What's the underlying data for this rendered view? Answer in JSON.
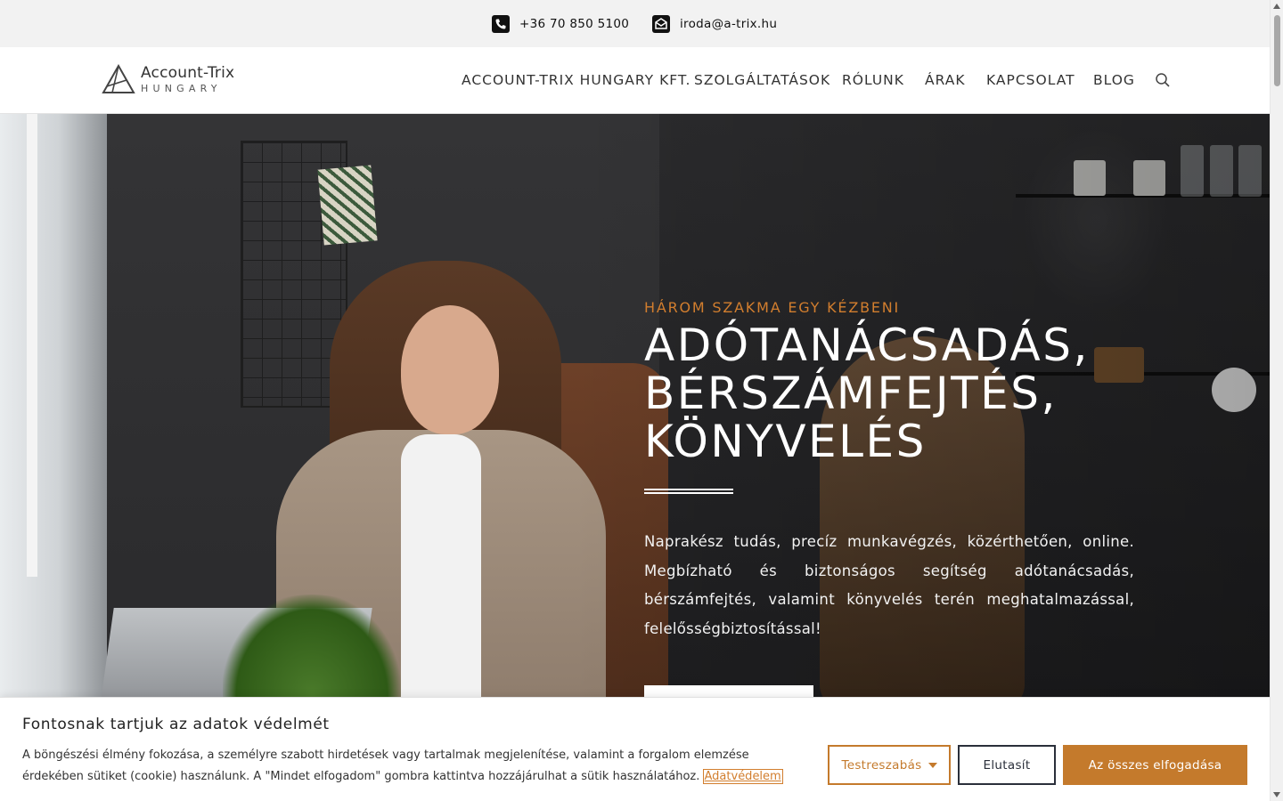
{
  "topbar": {
    "phone_icon": "phone-icon",
    "phone": "+36 70 850 5100",
    "mail_icon": "mail-icon",
    "email": "iroda@a-trix.hu"
  },
  "header": {
    "logo": {
      "name": "Account-Trix",
      "sub": "HUNGARY"
    },
    "nav": [
      {
        "label": "ACCOUNT-TRIX HUNGARY KFT."
      },
      {
        "label": "SZOLGÁLTATÁSOK"
      },
      {
        "label": "RÓLUNK"
      },
      {
        "label": "ÁRAK"
      },
      {
        "label": "KAPCSOLAT"
      },
      {
        "label": "BLOG"
      }
    ],
    "search_icon": "search-icon"
  },
  "hero": {
    "kicker": "HÁROM SZAKMA EGY KÉZBENI",
    "headline": [
      "ADÓTANÁCSADÁS,",
      "BÉRSZÁMFEJTÉS,",
      "KÖNYVELÉS"
    ],
    "description": "Naprakész tudás, precíz munkavégzés, közérthetően, online. Megbízható és biztonságos segítség adótanácsadás, bérszámfejtés, valamint könyvelés terén meghatalmazással, felelősségbiztosítással!"
  },
  "cookie": {
    "title": "Fontosnak tartjuk az adatok védelmét",
    "text": "A böngészési élmény fokozása, a személyre szabott hirdetések vagy tartalmak megjelenítése, valamint a forgalom elemzése érdekében sütiket (cookie) használunk. A \"Mindet elfogadom\" gombra kattintva hozzájárulhat a sütik használatához.",
    "link": "Adatvédelem",
    "customize": "Testreszabás",
    "reject": "Elutasít",
    "accept": "Az összes elfogadása"
  },
  "colors": {
    "accent": "#c47a2c",
    "kicker": "#d27e2e",
    "dark_button_border": "#2a2f3a"
  }
}
